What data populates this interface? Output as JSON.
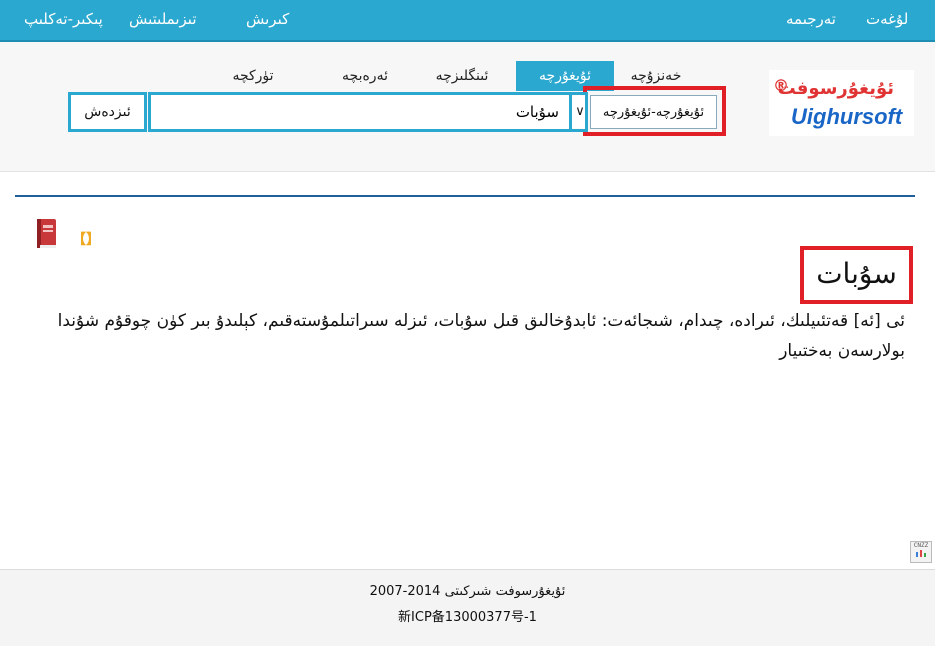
{
  "topbar": {
    "left_links": [
      "كىرىش",
      "تىزىملىتىش",
      "پىكىر-تەكلىپ"
    ],
    "right_links": [
      "لۇغەت",
      "تەرجىمە"
    ]
  },
  "logo": {
    "text": "ئۇيغۇرسوفت",
    "reg": "®",
    "en": "Uighursoft"
  },
  "tabs": [
    {
      "label": "خەنزۇچە",
      "active": false
    },
    {
      "label": "ئۇيغۇرچە",
      "active": true
    },
    {
      "label": "ئىنگلىزچە",
      "active": false
    },
    {
      "label": "ئەرەبچە",
      "active": false
    },
    {
      "label": "تۈركچە",
      "active": false
    }
  ],
  "search": {
    "dictionary": "ئۇيغۇرچە-ئۇيغۇرچە",
    "query": "سۇبات",
    "dropdown_glyph": "∨",
    "button": "ئىزدەش"
  },
  "result": {
    "bracket": "【】",
    "headword": "سۇبات",
    "definition": "ئى [ئە] قەتئىيلىك، ئىرادە، چىدام، شىجائەت: ئابدۇخالىق قىل سۇبات، ئىزلە سىراتىلمۇستەقىم، كېلىدۇ بىر كۈن چوقۇم شۇندا بولارسەن بەختىيار"
  },
  "cnzz": "CNZZ",
  "footer": {
    "copyright": "2007-2014 ئۇيغۇرسوفت شىركىتى",
    "icp": "新ICP备13000377号-1"
  },
  "colors": {
    "accent": "#2ba8cf",
    "highlight": "#e01f26",
    "rule": "#1f5f9a"
  }
}
